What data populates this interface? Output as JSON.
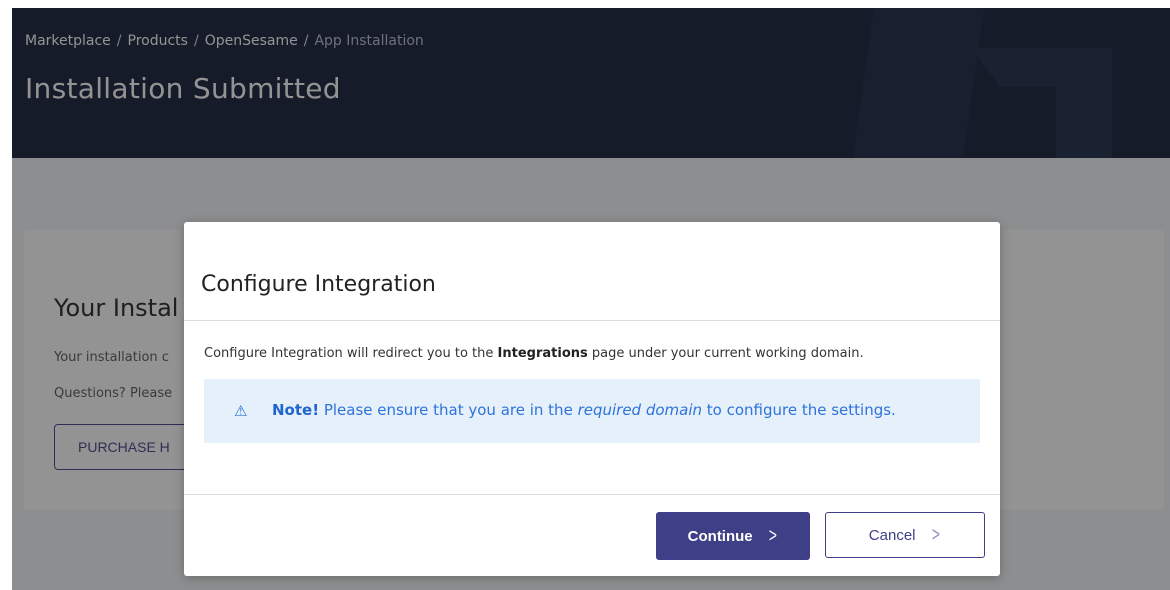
{
  "breadcrumb": {
    "items": [
      "Marketplace",
      "Products",
      "OpenSesame",
      "App Installation"
    ],
    "separator": "/"
  },
  "page": {
    "title": "Installation Submitted"
  },
  "card": {
    "title": "Your Instal",
    "line1": "Your installation c",
    "line2": "Questions? Please",
    "button_label": "PURCHASE H"
  },
  "modal": {
    "title": "Configure Integration",
    "desc_before": "Configure Integration will redirect you to the ",
    "desc_bold": "Integrations",
    "desc_after": " page under your current working domain.",
    "note": {
      "icon": "warning-icon",
      "icon_glyph": "⚠",
      "label": "Note!",
      "text_before": " Please ensure that you are in the ",
      "text_italic": "required domain",
      "text_after": " to configure the settings."
    },
    "continue_label": "Continue",
    "cancel_label": "Cancel",
    "chevron_glyph": ">"
  },
  "colors": {
    "header_bg": "#0f1a35",
    "primary": "#3f3f88",
    "note_bg": "#e6f0fb",
    "note_text": "#2d73db"
  }
}
